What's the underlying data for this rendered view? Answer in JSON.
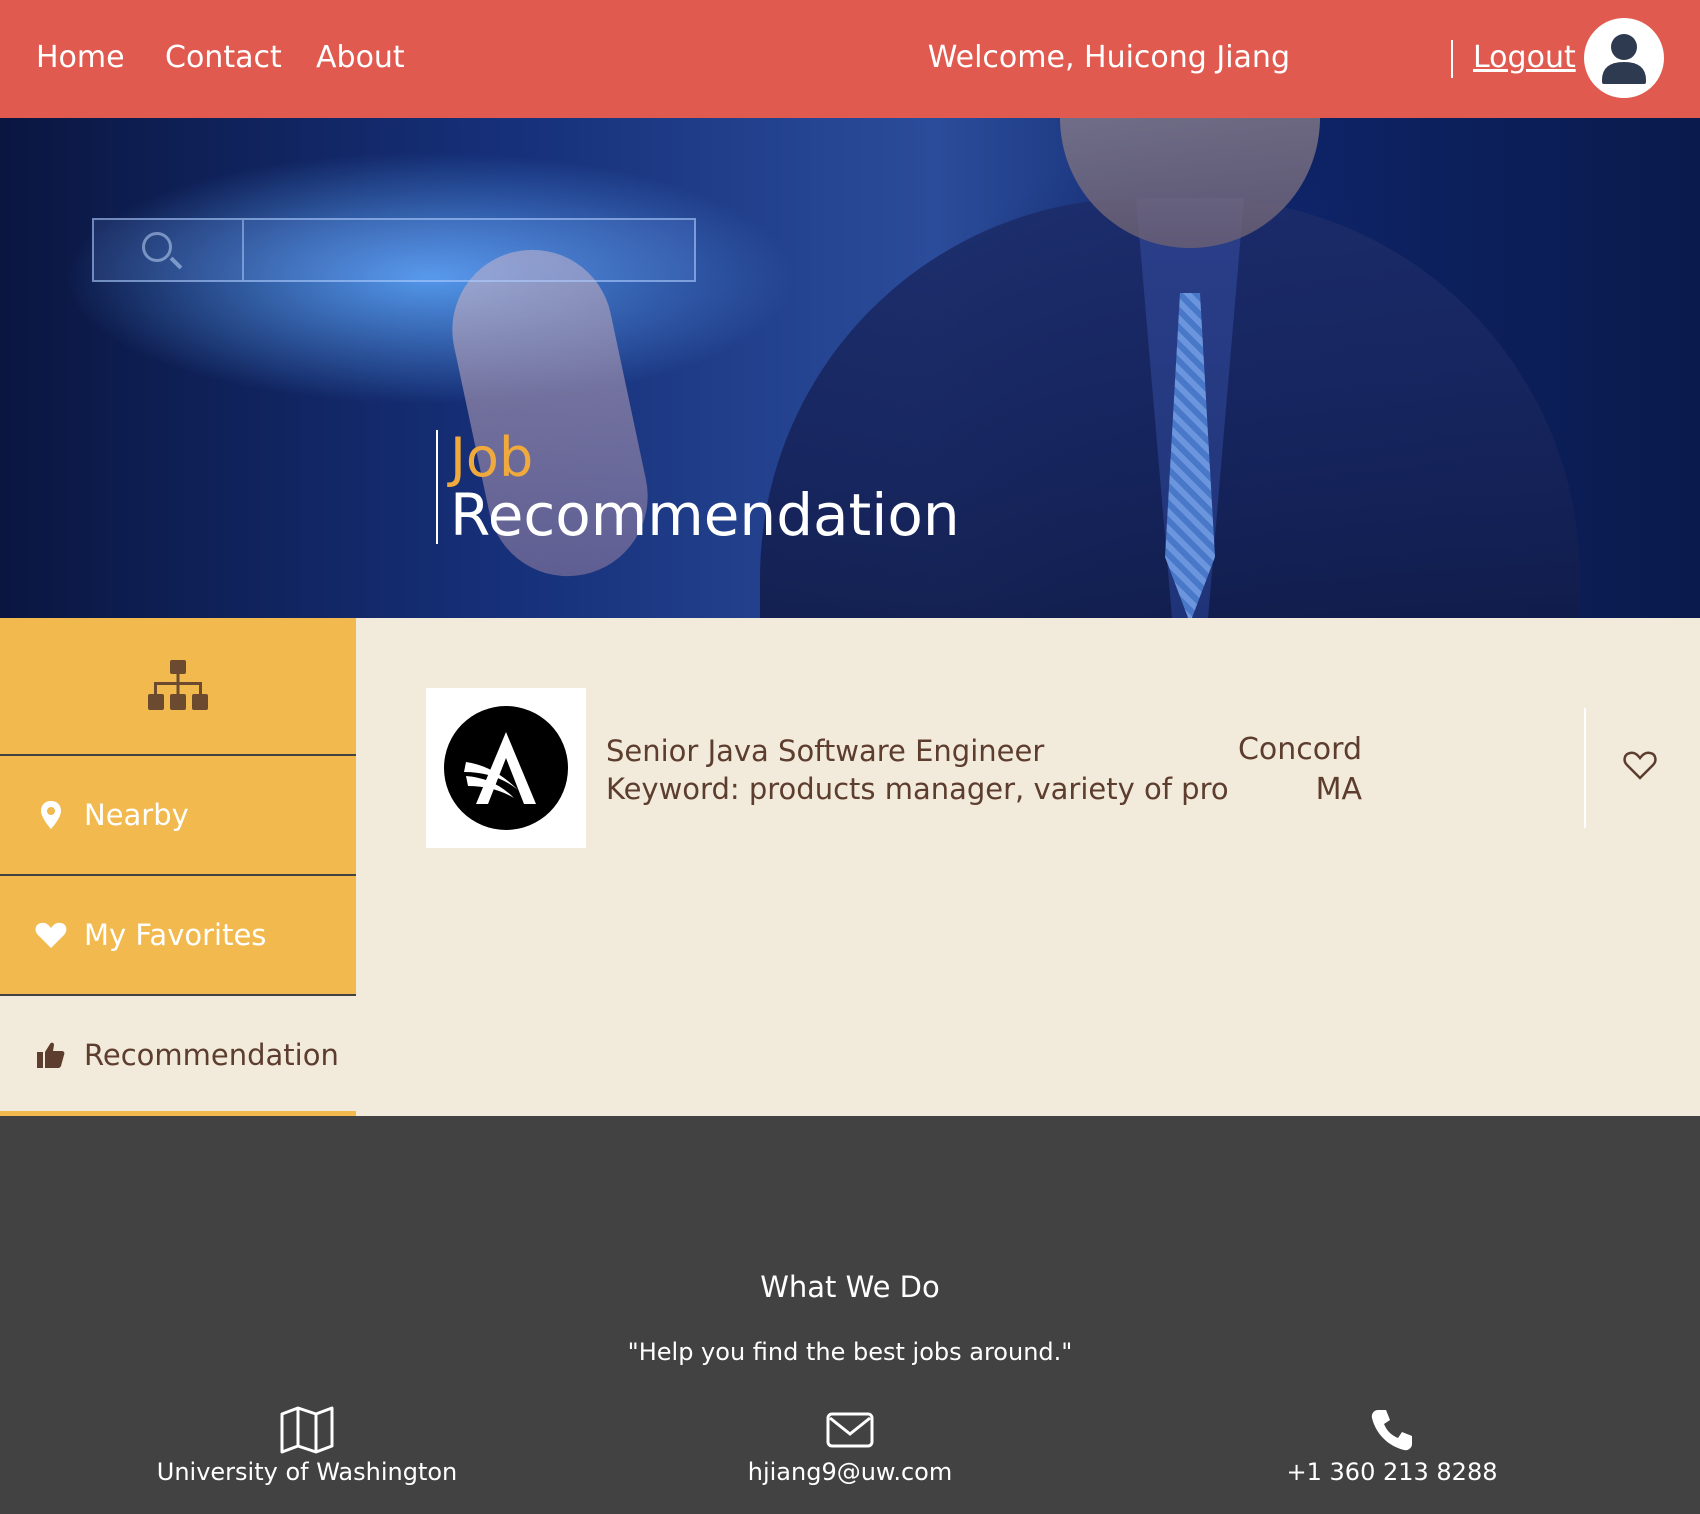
{
  "nav": {
    "home": "Home",
    "contact": "Contact",
    "about": "About",
    "welcome": "Welcome, Huicong Jiang",
    "logout": "Logout"
  },
  "hero": {
    "title_line1": "Job",
    "title_line2": "Recommendation"
  },
  "sidebar": {
    "items": [
      {
        "label": "Nearby",
        "icon": "map-pin-icon"
      },
      {
        "label": "My Favorites",
        "icon": "heart-icon"
      },
      {
        "label": "Recommendation",
        "icon": "thumbs-up-icon",
        "active": true
      }
    ]
  },
  "jobs": [
    {
      "title": "Senior Java Software Engineer",
      "keyword": "Keyword: products manager, variety of project, li",
      "city": "Concord",
      "state": "MA",
      "favorited": false
    }
  ],
  "footer": {
    "title": "What We Do",
    "quote": "\"Help you find the best jobs around.\"",
    "address": "University of Washington",
    "email": "hjiang9@uw.com",
    "phone": "+1 360 213 8288"
  },
  "colors": {
    "nav_bg": "#e05a4f",
    "sidebar_bg": "#f2b94f",
    "content_bg": "#f2eadb",
    "text_brown": "#5c3d2e",
    "footer_bg": "#424242",
    "title_accent": "#f0a93c"
  }
}
